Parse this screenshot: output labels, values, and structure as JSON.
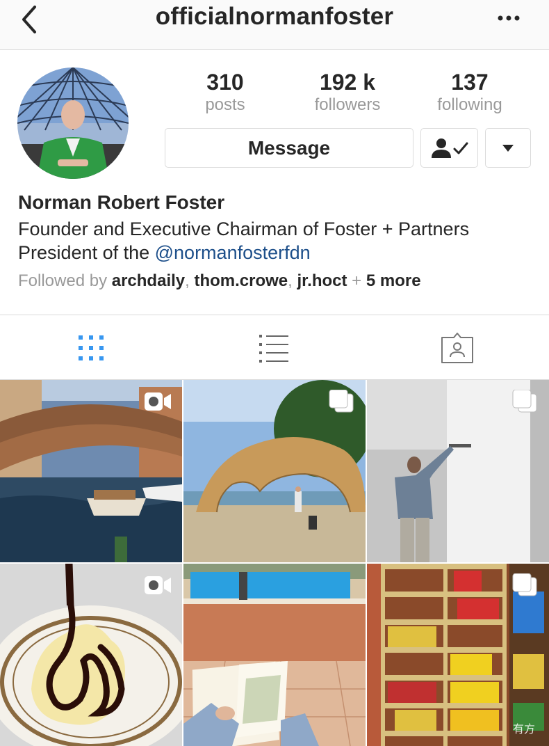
{
  "header": {
    "username": "officialnormanfoster"
  },
  "profile": {
    "stats": [
      {
        "value": "310",
        "label": "posts"
      },
      {
        "value": "192 k",
        "label": "followers"
      },
      {
        "value": "137",
        "label": "following"
      }
    ],
    "message_label": "Message",
    "name": "Norman Robert Foster",
    "bio_line1": "Founder and Executive Chairman of Foster + Partners",
    "bio_line2_prefix": "President of the ",
    "bio_mention": "@normanfosterfdn",
    "followed_prefix": "Followed by ",
    "followed_users": [
      "archdaily",
      "thom.crowe",
      "jr.hoct"
    ],
    "followed_more": "5 more"
  },
  "grid": {
    "posts": [
      {
        "type": "video",
        "scene": "venice-canal-bridge"
      },
      {
        "type": "carousel",
        "scene": "brick-vault-pavilion"
      },
      {
        "type": "carousel",
        "scene": "man-opening-door"
      },
      {
        "type": "video",
        "scene": "dessert-chocolate-sauce"
      },
      {
        "type": "carousel",
        "scene": "sketching-by-pool"
      },
      {
        "type": "carousel",
        "scene": "archive-shelves"
      }
    ],
    "watermark": "有方"
  },
  "colors": {
    "accent": "#3897f0",
    "mention": "#1d4f8a",
    "muted": "#999999",
    "border": "#dbdbdb"
  }
}
